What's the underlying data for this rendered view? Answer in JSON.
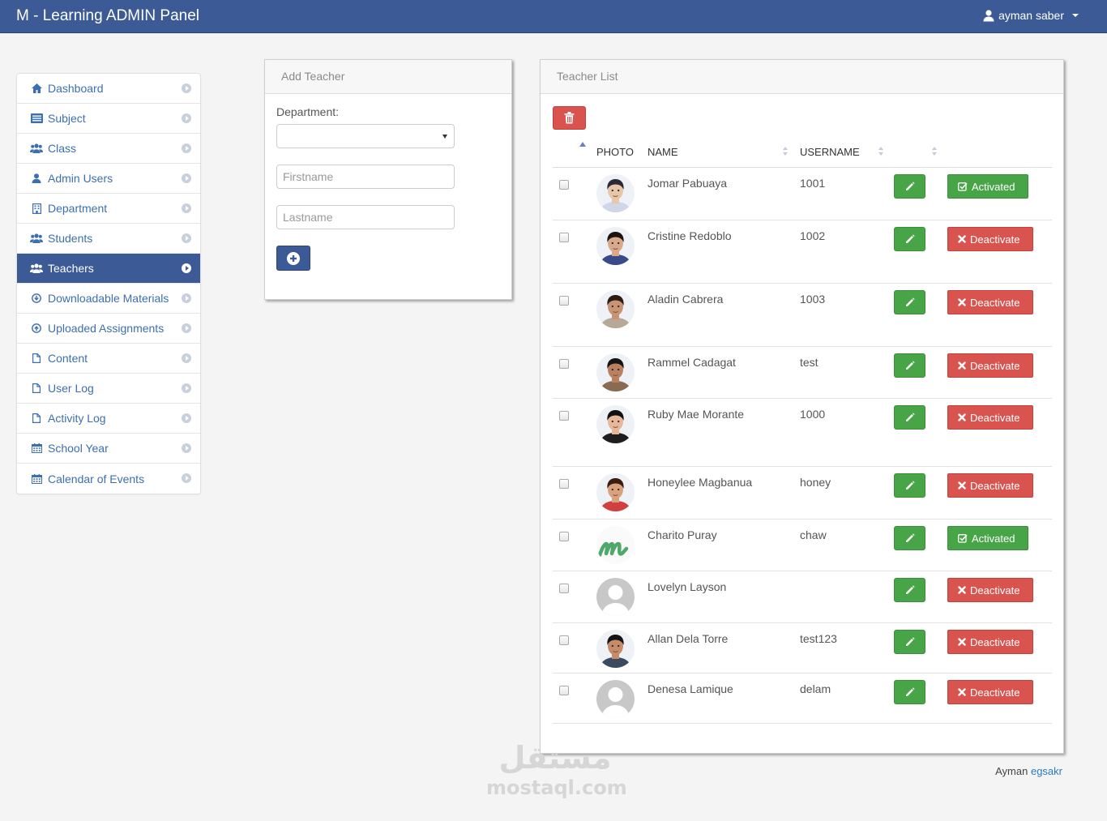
{
  "app": {
    "title": "M - Learning ADMIN Panel",
    "user": "ayman saber"
  },
  "sidebar": {
    "items": [
      {
        "label": "Dashboard",
        "icon": "home-icon",
        "active": false
      },
      {
        "label": "Subject",
        "icon": "list-icon",
        "active": false
      },
      {
        "label": "Class",
        "icon": "group-icon",
        "active": false
      },
      {
        "label": "Admin Users",
        "icon": "user-icon",
        "active": false
      },
      {
        "label": "Department",
        "icon": "building-icon",
        "active": false
      },
      {
        "label": "Students",
        "icon": "group-icon",
        "active": false
      },
      {
        "label": "Teachers",
        "icon": "group-icon",
        "active": true
      },
      {
        "label": "Downloadable Materials",
        "icon": "download-icon",
        "active": false
      },
      {
        "label": "Uploaded Assignments",
        "icon": "upload-icon",
        "active": false
      },
      {
        "label": "Content",
        "icon": "file-icon",
        "active": false
      },
      {
        "label": "User Log",
        "icon": "file-icon",
        "active": false
      },
      {
        "label": "Activity Log",
        "icon": "file-icon",
        "active": false
      },
      {
        "label": "School Year",
        "icon": "calendar-icon",
        "active": false
      },
      {
        "label": "Calendar of Events",
        "icon": "calendar-icon",
        "active": false
      }
    ]
  },
  "add_teacher": {
    "title": "Add Teacher",
    "department_label": "Department:",
    "department_value": "",
    "firstname_placeholder": "Firstname",
    "lastname_placeholder": "Lastname"
  },
  "teacher_list": {
    "title": "Teacher List",
    "columns": {
      "photo": "PHOTO",
      "name": "NAME",
      "username": "USERNAME"
    },
    "rows": [
      {
        "name": "Jomar Pabuaya",
        "username": "1001",
        "status": "Activated",
        "photo": "portrait"
      },
      {
        "name": "Cristine Redoblo",
        "username": "1002",
        "status": "Deactivate",
        "photo": "portrait"
      },
      {
        "name": "Aladin Cabrera",
        "username": "1003",
        "status": "Deactivate",
        "photo": "portrait"
      },
      {
        "name": "Rammel Cadagat",
        "username": "test",
        "status": "Deactivate",
        "photo": "portrait"
      },
      {
        "name": "Ruby Mae Morante",
        "username": "1000",
        "status": "Deactivate",
        "photo": "portrait"
      },
      {
        "name": "Honeylee Magbanua",
        "username": "honey",
        "status": "Deactivate",
        "photo": "portrait"
      },
      {
        "name": "Charito Puray",
        "username": "chaw",
        "status": "Activated",
        "photo": "logo"
      },
      {
        "name": "Lovelyn Layson",
        "username": "",
        "status": "Deactivate",
        "photo": "placeholder"
      },
      {
        "name": "Allan Dela Torre",
        "username": "test123",
        "status": "Deactivate",
        "photo": "portrait"
      },
      {
        "name": "Denesa Lamique",
        "username": "delam",
        "status": "Deactivate",
        "photo": "placeholder"
      }
    ]
  },
  "footer": {
    "prefix": "Ayman",
    "link": "egsakr"
  },
  "watermark": {
    "arabic": "مستقل",
    "latin": "mostaql.com"
  },
  "colors": {
    "primary": "#3c5a96",
    "success": "#47a447",
    "danger": "#d9534f"
  }
}
